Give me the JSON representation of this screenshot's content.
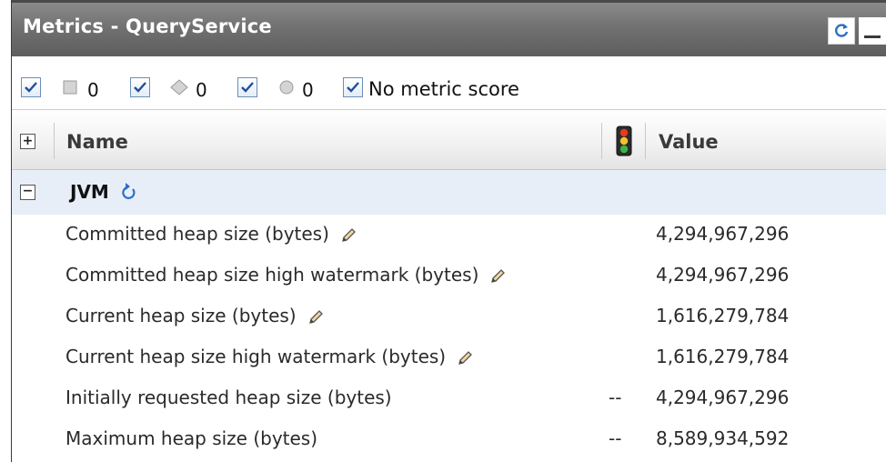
{
  "panel": {
    "title": "Metrics - QueryService"
  },
  "filters": [
    {
      "icon": "square-severity-icon",
      "checked": true,
      "count": "0"
    },
    {
      "icon": "diamond-severity-icon",
      "checked": true,
      "count": "0"
    },
    {
      "icon": "circle-severity-icon",
      "checked": true,
      "count": "0"
    },
    {
      "checked": true,
      "label": "No metric score"
    }
  ],
  "table": {
    "columns": {
      "name": "Name",
      "status_icon": "traffic-light-icon",
      "value": "Value"
    },
    "group": {
      "name": "JVM",
      "icon": "refresh-icon"
    },
    "rows": [
      {
        "name": "Committed heap size (bytes)",
        "editable": true,
        "status": "",
        "value": "4,294,967,296"
      },
      {
        "name": "Committed heap size high watermark (bytes)",
        "editable": true,
        "status": "",
        "value": "4,294,967,296"
      },
      {
        "name": "Current heap size (bytes)",
        "editable": true,
        "status": "",
        "value": "1,616,279,784"
      },
      {
        "name": "Current heap size high watermark (bytes)",
        "editable": true,
        "status": "",
        "value": "1,616,279,784"
      },
      {
        "name": "Initially requested heap size (bytes)",
        "editable": false,
        "status": "--",
        "value": "4,294,967,296"
      },
      {
        "name": "Maximum heap size (bytes)",
        "editable": false,
        "status": "--",
        "value": "8,589,934,592"
      }
    ]
  },
  "colors": {
    "titlebar": "#6f6f6f",
    "group_row": "#e8eef7",
    "checkbox_border": "#6d8fb8",
    "check_mark": "#1f4f9a"
  }
}
